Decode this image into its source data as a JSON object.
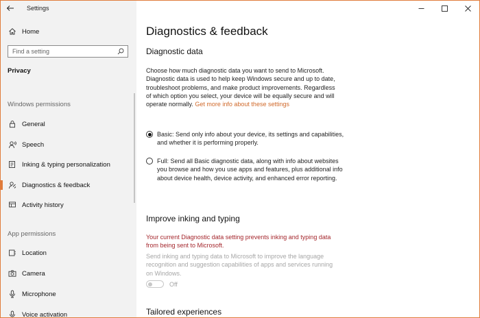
{
  "window": {
    "title": "Settings"
  },
  "sidebar": {
    "home_label": "Home",
    "search_placeholder": "Find a setting",
    "category": "Privacy",
    "sections": [
      {
        "header": "Windows permissions",
        "items": [
          {
            "label": "General",
            "icon": "lock-icon"
          },
          {
            "label": "Speech",
            "icon": "speech-icon"
          },
          {
            "label": "Inking & typing personalization",
            "icon": "inking-icon"
          },
          {
            "label": "Diagnostics & feedback",
            "icon": "diagnostics-icon",
            "selected": true
          },
          {
            "label": "Activity history",
            "icon": "activity-icon"
          }
        ]
      },
      {
        "header": "App permissions",
        "items": [
          {
            "label": "Location",
            "icon": "location-icon"
          },
          {
            "label": "Camera",
            "icon": "camera-icon"
          },
          {
            "label": "Microphone",
            "icon": "microphone-icon"
          },
          {
            "label": "Voice activation",
            "icon": "voice-icon"
          }
        ]
      }
    ]
  },
  "main": {
    "page_title": "Diagnostics & feedback",
    "diagnostic": {
      "title": "Diagnostic data",
      "description": "Choose how much diagnostic data you want to send to Microsoft. Diagnostic data is used to help keep Windows secure and up to date, troubleshoot problems, and make product improvements. Regardless of which option you select, your device will be equally secure and will operate normally.",
      "link": "Get more info about these settings",
      "options": [
        {
          "label": "Basic: Send only info about your device, its settings and capabilities, and whether it is performing properly.",
          "checked": true
        },
        {
          "label": "Full: Send all Basic diagnostic data, along with info about websites you browse and how you use apps and features, plus additional info about device health, device activity, and enhanced error reporting.",
          "checked": false
        }
      ]
    },
    "inking": {
      "title": "Improve inking and typing",
      "warning": "Your current Diagnostic data setting prevents inking and typing data from being sent to Microsoft.",
      "description": "Send inking and typing data to Microsoft to improve the language recognition and suggestion capabilities of apps and services running on Windows.",
      "toggle_state": "Off"
    },
    "tailored": {
      "title": "Tailored experiences"
    }
  },
  "colors": {
    "accent": "#e07b3a",
    "link": "#d0692a",
    "warning": "#a4262c",
    "disabled": "#a6a6a6"
  }
}
